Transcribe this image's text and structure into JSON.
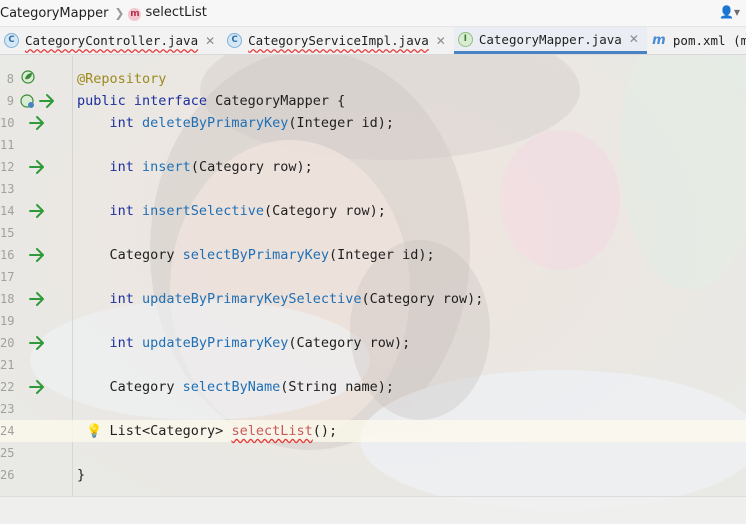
{
  "breadcrumb": {
    "items": [
      {
        "label": "CategoryMapper",
        "icon": "none"
      },
      {
        "label": "selectList",
        "icon": "method-icon",
        "badge": "m"
      }
    ]
  },
  "tabs": [
    {
      "label": "CategoryController.java",
      "icon_letter": "C",
      "icon": "class-icon",
      "error": true,
      "active": false
    },
    {
      "label": "CategoryServiceImpl.java",
      "icon_letter": "C",
      "icon": "class-icon",
      "error": true,
      "active": false
    },
    {
      "label": "CategoryMapper.java",
      "icon_letter": "I",
      "icon": "interface-icon",
      "error": false,
      "active": true
    },
    {
      "label": "pom.xml (mal)",
      "icon_letter": "m",
      "icon": "maven-icon",
      "error": false,
      "active": false
    }
  ],
  "code": {
    "lines": [
      {
        "num": "8",
        "gutter": "spring-bean-icon",
        "parts": [
          [
            "ann",
            "@Repository"
          ]
        ]
      },
      {
        "num": "9",
        "gutter": "implemented-icon",
        "parts": [
          [
            "kw",
            "public interface "
          ],
          [
            "plain",
            "CategoryMapper {"
          ]
        ]
      },
      {
        "num": "10",
        "gutter": "arrow-right-icon",
        "parts": [
          [
            "plain",
            "    "
          ],
          [
            "kw",
            "int "
          ],
          [
            "fn",
            "deleteByPrimaryKey"
          ],
          [
            "plain",
            "(Integer id);"
          ]
        ]
      },
      {
        "num": "11",
        "gutter": "",
        "parts": []
      },
      {
        "num": "12",
        "gutter": "arrow-right-icon",
        "parts": [
          [
            "plain",
            "    "
          ],
          [
            "kw",
            "int "
          ],
          [
            "fn",
            "insert"
          ],
          [
            "plain",
            "(Category row);"
          ]
        ]
      },
      {
        "num": "13",
        "gutter": "",
        "parts": []
      },
      {
        "num": "14",
        "gutter": "arrow-right-icon",
        "parts": [
          [
            "plain",
            "    "
          ],
          [
            "kw",
            "int "
          ],
          [
            "fn",
            "insertSelective"
          ],
          [
            "plain",
            "(Category row);"
          ]
        ]
      },
      {
        "num": "15",
        "gutter": "",
        "parts": []
      },
      {
        "num": "16",
        "gutter": "arrow-right-icon",
        "parts": [
          [
            "plain",
            "    Category "
          ],
          [
            "fn",
            "selectByPrimaryKey"
          ],
          [
            "plain",
            "(Integer id);"
          ]
        ]
      },
      {
        "num": "17",
        "gutter": "",
        "parts": []
      },
      {
        "num": "18",
        "gutter": "arrow-right-icon",
        "parts": [
          [
            "plain",
            "    "
          ],
          [
            "kw",
            "int "
          ],
          [
            "fn",
            "updateByPrimaryKeySelective"
          ],
          [
            "plain",
            "(Category row);"
          ]
        ]
      },
      {
        "num": "19",
        "gutter": "",
        "parts": []
      },
      {
        "num": "20",
        "gutter": "arrow-right-icon",
        "parts": [
          [
            "plain",
            "    "
          ],
          [
            "kw",
            "int "
          ],
          [
            "fn",
            "updateByPrimaryKey"
          ],
          [
            "plain",
            "(Category row);"
          ]
        ]
      },
      {
        "num": "21",
        "gutter": "",
        "parts": []
      },
      {
        "num": "22",
        "gutter": "arrow-right-icon",
        "parts": [
          [
            "plain",
            "    Category "
          ],
          [
            "fn",
            "selectByName"
          ],
          [
            "plain",
            "(String name);"
          ]
        ]
      },
      {
        "num": "23",
        "gutter": "",
        "parts": []
      },
      {
        "num": "24",
        "gutter": "",
        "bulb": true,
        "current": true,
        "parts": [
          [
            "plain",
            "    List<Category> "
          ],
          [
            "fnerr",
            "selectList"
          ],
          [
            "plain",
            "();"
          ]
        ]
      },
      {
        "num": "25",
        "gutter": "",
        "parts": []
      },
      {
        "num": "26",
        "gutter": "",
        "parts": [
          [
            "plain",
            "}"
          ]
        ]
      }
    ]
  },
  "colors": {
    "keyword": "#1d2f9e",
    "annotation": "#9b8a1f",
    "method": "#1f6fb5",
    "error": "#e53c3c",
    "active_tab_accent": "#4a83c4",
    "gutter_arrow": "#2f9a3a"
  }
}
